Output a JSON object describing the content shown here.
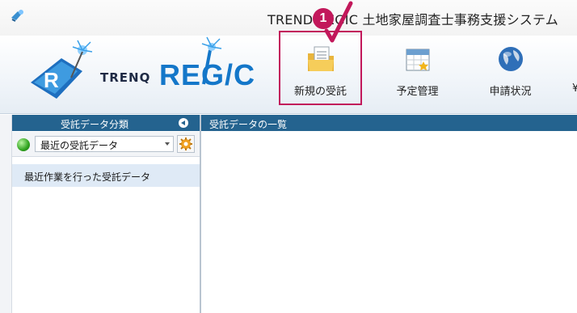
{
  "window": {
    "title": "TREND REGIC 土地家屋調査士事務支援システム"
  },
  "logo": {
    "trend": "TRENQ",
    "regic": "REG/C"
  },
  "ribbon": {
    "buttons": [
      {
        "label": "新規の受託",
        "icon": "folder-document-icon"
      },
      {
        "label": "予定管理",
        "icon": "calendar-icon"
      },
      {
        "label": "申請状況",
        "icon": "globe-icon"
      }
    ]
  },
  "callout": {
    "number": "1"
  },
  "left_panel": {
    "header": "受託データ分類",
    "combo_value": "最近の受託データ",
    "item": "最近作業を行った受託データ"
  },
  "right_panel": {
    "header": "受託データの一覧"
  },
  "colors": {
    "header_blue": "#24638f",
    "logo_blue": "#1477c9",
    "highlight": "#c2185b"
  }
}
